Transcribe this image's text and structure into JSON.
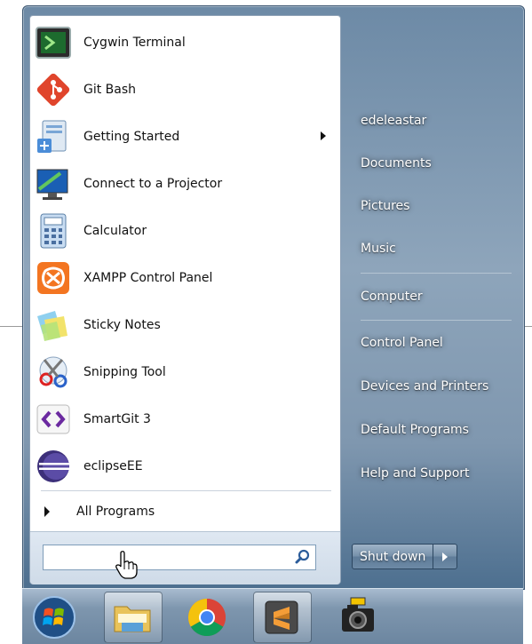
{
  "programs": [
    {
      "label": "Cygwin Terminal",
      "icon": "terminal-icon"
    },
    {
      "label": "Git Bash",
      "icon": "git-icon"
    },
    {
      "label": "Getting Started",
      "icon": "getting-started-icon",
      "has_submenu": true
    },
    {
      "label": "Connect to a Projector",
      "icon": "projector-icon"
    },
    {
      "label": "Calculator",
      "icon": "calculator-icon"
    },
    {
      "label": "XAMPP Control Panel",
      "icon": "xampp-icon"
    },
    {
      "label": "Sticky Notes",
      "icon": "sticky-notes-icon"
    },
    {
      "label": "Snipping Tool",
      "icon": "scissors-icon"
    },
    {
      "label": "SmartGit 3",
      "icon": "smartgit-icon"
    },
    {
      "label": "eclipseEE",
      "icon": "eclipse-icon"
    }
  ],
  "all_programs_label": "All Programs",
  "search": {
    "value": "",
    "placeholder": ""
  },
  "right_items": [
    "edeleastar",
    "Documents",
    "Pictures",
    "Music",
    "Computer",
    "Control Panel",
    "Devices and Printers",
    "Default Programs",
    "Help and Support"
  ],
  "shutdown_label": "Shut down",
  "taskbar": [
    "start-orb-icon",
    "file-explorer-icon",
    "chrome-icon",
    "sublime-text-icon",
    "camera-icon"
  ],
  "colors": {
    "accent": "#6d8aa6",
    "menu_text": "#111111"
  }
}
